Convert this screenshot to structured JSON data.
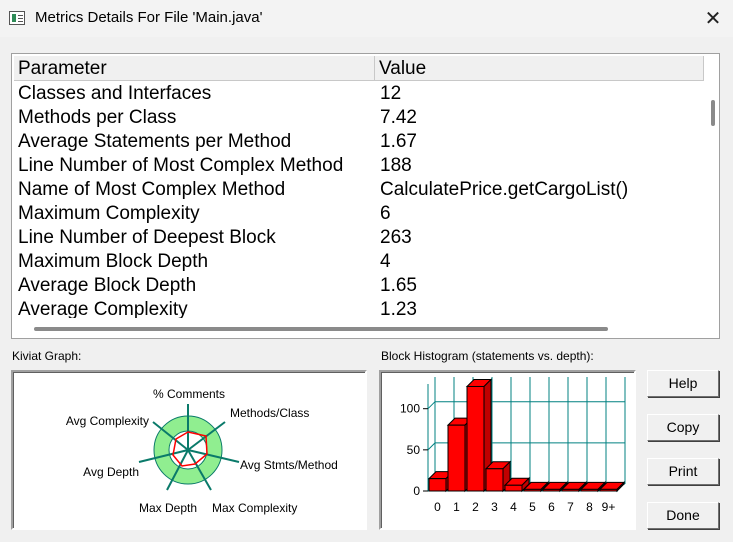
{
  "window": {
    "title": "Metrics Details For File 'Main.java'",
    "close_glyph": "✕"
  },
  "table": {
    "headers": {
      "parameter": "Parameter",
      "value": "Value"
    },
    "rows": [
      {
        "param": "Classes and Interfaces",
        "value": "12"
      },
      {
        "param": "Methods per Class",
        "value": "7.42"
      },
      {
        "param": "Average Statements per Method",
        "value": "1.67"
      },
      {
        "param": "Line Number of Most Complex Method",
        "value": "188"
      },
      {
        "param": "Name of Most Complex Method",
        "value": "CalculatePrice.getCargoList()"
      },
      {
        "param": "Maximum Complexity",
        "value": "6"
      },
      {
        "param": "Line Number of Deepest Block",
        "value": "263"
      },
      {
        "param": "Maximum Block Depth",
        "value": "4"
      },
      {
        "param": "Average Block Depth",
        "value": "1.65"
      },
      {
        "param": "Average Complexity",
        "value": "1.23"
      }
    ]
  },
  "kiviat": {
    "label": "Kiviat Graph:",
    "axes": [
      "% Comments",
      "Methods/Class",
      "Avg Stmts/Method",
      "Max Complexity",
      "Max Depth",
      "Avg Depth",
      "Avg Complexity"
    ]
  },
  "histogram": {
    "label": "Block Histogram (statements vs. depth):",
    "y_ticks": [
      "100",
      "50",
      "0"
    ],
    "x_labels": [
      "0",
      "1",
      "2",
      "3",
      "4",
      "5",
      "6",
      "7",
      "8",
      "9+"
    ]
  },
  "chart_data": {
    "type": "bar",
    "categories": [
      "0",
      "1",
      "2",
      "3",
      "4",
      "5",
      "6",
      "7",
      "8",
      "9+"
    ],
    "values": [
      15,
      80,
      127,
      27,
      7,
      2,
      2,
      2,
      2,
      2
    ],
    "title": "",
    "xlabel": "",
    "ylabel": "",
    "ylim": [
      0,
      130
    ]
  },
  "buttons": {
    "help": "Help",
    "copy": "Copy",
    "print": "Print",
    "done": "Done"
  },
  "colors": {
    "bar": "#ff0000",
    "grid": "#008080",
    "kiviat_band": "#90ee90"
  }
}
